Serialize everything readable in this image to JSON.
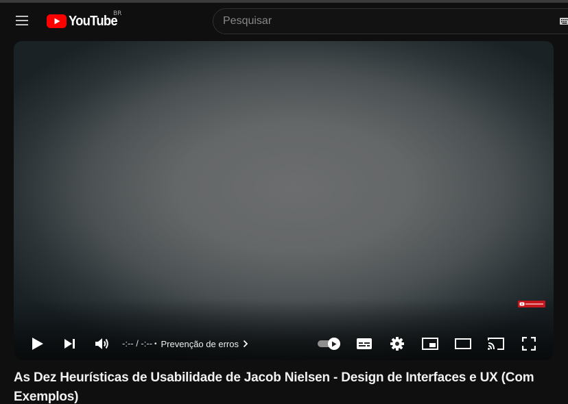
{
  "masthead": {
    "logo_text": "YouTube",
    "country_code": "BR",
    "search_placeholder": "Pesquisar"
  },
  "player": {
    "time_display": "-:-- / -:--",
    "chapter_separator": "•",
    "chapter_title": "Prevenção de erros",
    "autoplay_enabled": true
  },
  "video": {
    "title": "As Dez Heurísticas de Usabilidade de Jacob Nielsen - Design de Interfaces e UX (Com Exemplos)"
  },
  "colors": {
    "background": "#0f0f0f",
    "brand_red": "#ff0000",
    "text_primary": "#f1f1f1",
    "text_secondary": "#aaaaaa"
  },
  "icons": {
    "menu": "hamburger-menu-icon",
    "logo": "youtube-play-logo",
    "keyboard": "keyboard-icon",
    "play": "play-icon",
    "next": "skip-next-icon",
    "volume": "volume-icon",
    "chevron": "chevron-right-icon",
    "autoplay": "autoplay-toggle",
    "subtitles": "subtitles-icon",
    "settings": "gear-icon",
    "miniplayer": "miniplayer-icon",
    "theater": "theater-mode-icon",
    "cast": "cast-icon",
    "fullscreen": "fullscreen-icon"
  }
}
